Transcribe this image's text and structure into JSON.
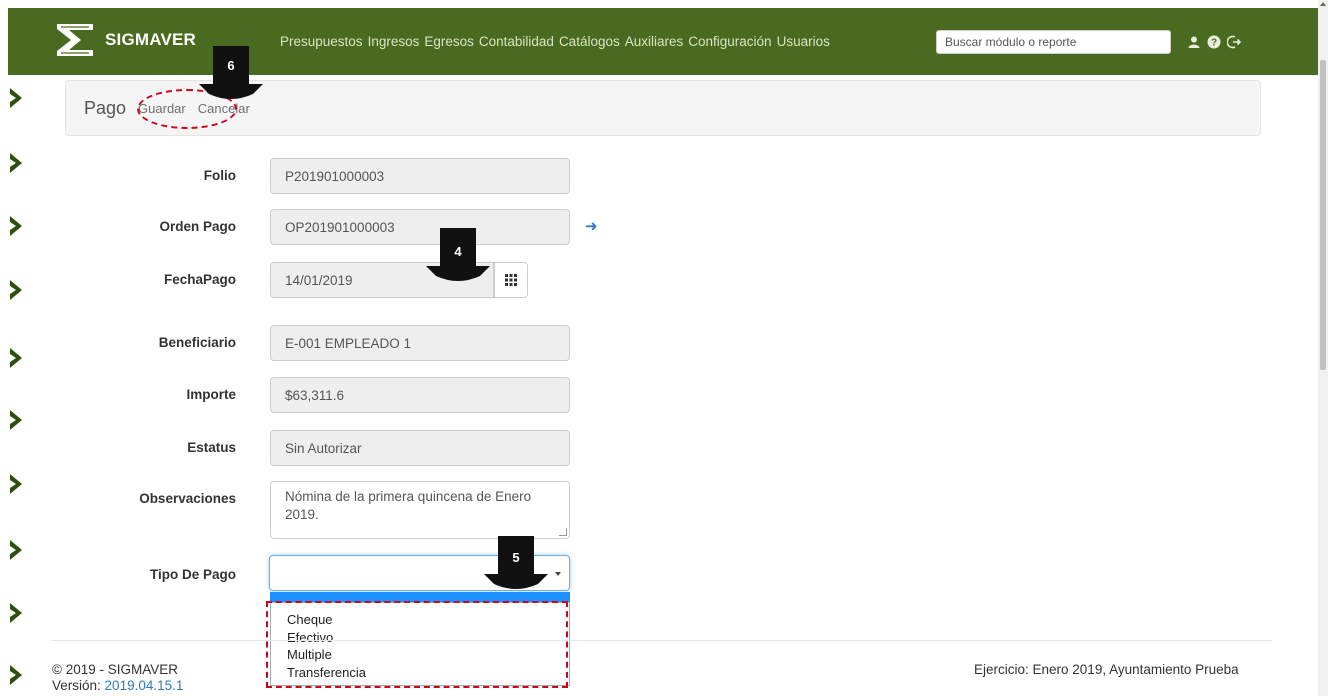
{
  "app": {
    "brand": "SIGMAVER",
    "menu": [
      "Presupuestos",
      "Ingresos",
      "Egresos",
      "Contabilidad",
      "Catálogos",
      "Auxiliares",
      "Configuración",
      "Usuarios"
    ],
    "search_placeholder": "Buscar módulo o reporte",
    "icons": [
      "user-icon",
      "help-icon",
      "logout-icon"
    ],
    "accent_color": "#4a6b1f"
  },
  "breadcrumb": {
    "title": "Pago",
    "save_label": "Guardar",
    "cancel_label": "Cancelar"
  },
  "form": {
    "folio_label": "Folio",
    "folio_value": "P201901000003",
    "orden_label": "Orden Pago",
    "orden_value": "OP201901000003",
    "fecha_label": "FechaPago",
    "fecha_value": "14/01/2019",
    "beneficiario_label": "Beneficiario",
    "beneficiario_value": "E-001 EMPLEADO 1",
    "importe_label": "Importe",
    "importe_value": "$63,311.6",
    "estatus_label": "Estatus",
    "estatus_value": "Sin Autorizar",
    "observaciones_label": "Observaciones",
    "observaciones_value": "Nómina de la primera quincena de Enero 2019.",
    "tipo_label": "Tipo De Pago",
    "tipo_value": "",
    "tipo_options": [
      "Cheque",
      "Efectivo",
      "Multiple",
      "Transferencia"
    ]
  },
  "footer": {
    "copyright": "© 2019 - SIGMAVER",
    "version_label": "Versión:",
    "version_value": "2019.04.15.1",
    "ejercicio": "Ejercicio: Enero 2019, Ayuntamiento Prueba"
  },
  "annotations": {
    "step_save": "6",
    "step_date": "4",
    "step_tipo": "5",
    "highlight_color": "#d0021b"
  }
}
